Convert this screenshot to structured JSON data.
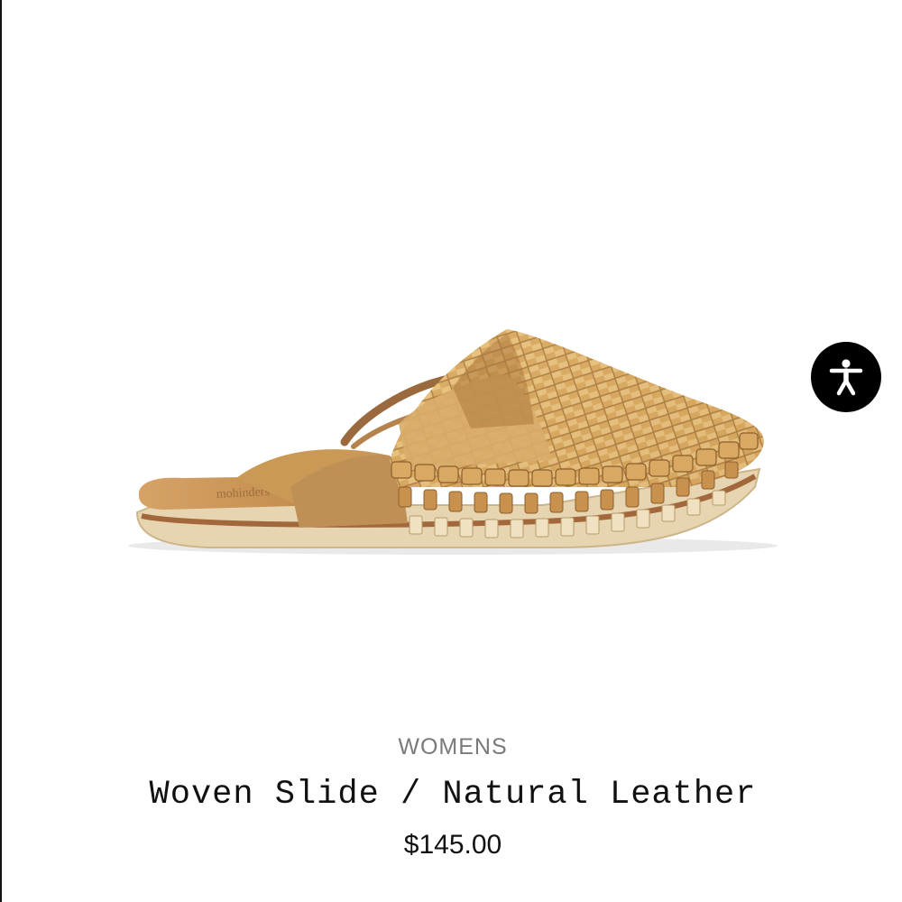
{
  "product": {
    "category": "WOMENS",
    "name": "Woven Slide / Natural Leather",
    "price": "$145.00",
    "image_icon": "woven-leather-slide-shoe",
    "colors": {
      "leather": "#c9954f",
      "leather_light": "#e2b877",
      "leather_dark": "#9a6a32",
      "sole": "#e6d3ae",
      "sole_edge": "#b27a47"
    }
  },
  "accessibility": {
    "icon": "accessibility-person-icon",
    "background": "#000000"
  }
}
